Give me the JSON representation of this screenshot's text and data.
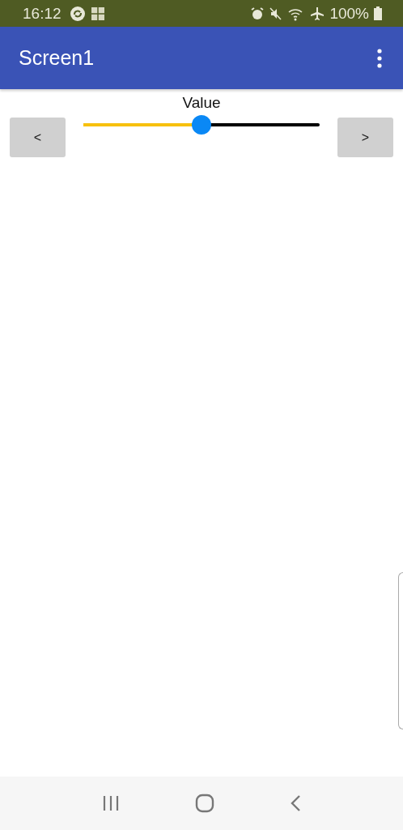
{
  "status_bar": {
    "time": "16:12",
    "battery": "100%"
  },
  "app_bar": {
    "title": "Screen1"
  },
  "slider": {
    "label": "Value",
    "level": 0.5
  },
  "buttons": [
    {
      "label": "<"
    },
    {
      "label": ">"
    }
  ]
}
